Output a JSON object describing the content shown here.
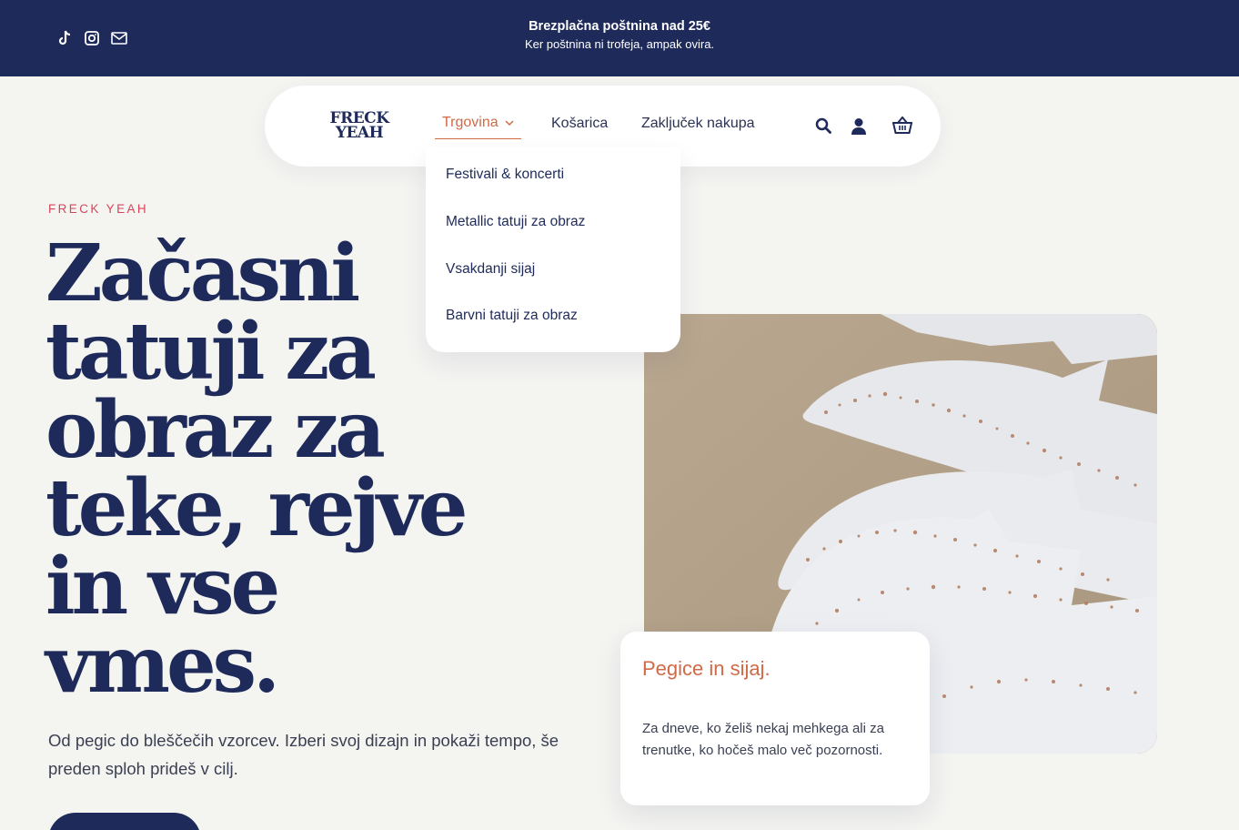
{
  "topbar": {
    "line1": "Brezplačna poštnina nad 25€",
    "line2": "Ker poštnina ni trofeja, ampak ovira.",
    "social_icons": [
      "tiktok-icon",
      "instagram-icon",
      "mail-icon"
    ]
  },
  "nav": {
    "logo_line1": "FRECK",
    "logo_line2": "YEAH",
    "shop_label": "Trgovina",
    "cart_label": "Košarica",
    "checkout_label": "Zaključek nakupa",
    "icons": [
      "search-icon",
      "user-icon",
      "basket-icon"
    ]
  },
  "dropdown": {
    "items": [
      "Festivali & koncerti",
      "Metallic tatuji za obraz",
      "Vsakdanji sijaj",
      "Barvni tatuji za obraz"
    ]
  },
  "hero": {
    "eyebrow": "FRECK YEAH",
    "headline_lines": [
      "Začasni",
      "tatuji za",
      "obraz za",
      "teke, rejve",
      "in vse",
      "vmes."
    ],
    "subtext": "Od pegic do bleščečih vzorcev. Izberi svoj dizajn in pokaži tempo, še preden sploh prideš v cilj."
  },
  "card": {
    "title": "Pegice in sijaj.",
    "text": "Za dneve, ko želiš nekaj mehkega ali za trenutke, ko hočeš malo več pozornosti."
  },
  "colors": {
    "navy": "#1e2a5a",
    "accent": "#d06a47",
    "eyebrow": "#d8455b",
    "background": "#f4f4f1"
  }
}
